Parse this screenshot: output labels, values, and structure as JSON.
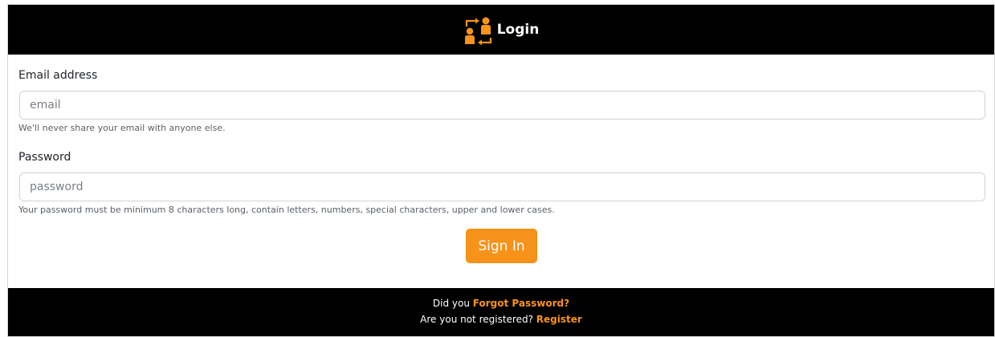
{
  "header": {
    "title": "Login",
    "icon": "user-exchange-icon",
    "accent_color": "#f7931a"
  },
  "email": {
    "label": "Email address",
    "placeholder": "email",
    "value": "",
    "help": "We'll never share your email with anyone else."
  },
  "password": {
    "label": "Password",
    "placeholder": "password",
    "value": "",
    "help": "Your password must be minimum 8 characters long, contain letters, numbers, special characters, upper and lower cases."
  },
  "signin": {
    "label": "Sign In",
    "color": "#f7931a"
  },
  "footer": {
    "forgot_prefix": "Did you ",
    "forgot_link": "Forgot Password?",
    "register_prefix": "Are you not registered? ",
    "register_link": "Register"
  }
}
